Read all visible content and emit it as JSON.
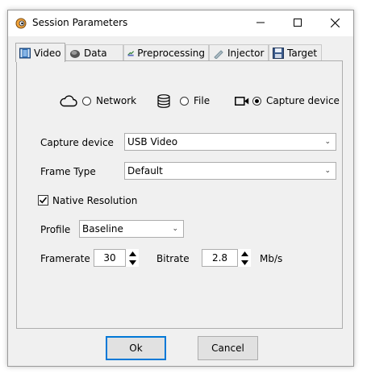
{
  "window": {
    "title": "Session Parameters"
  },
  "tabs": [
    {
      "label": "Video",
      "icon": "film-icon"
    },
    {
      "label": "Data",
      "icon": "disk-icon"
    },
    {
      "label": "Preprocessing",
      "icon": "preprocess-icon"
    },
    {
      "label": "Injector",
      "icon": "pen-icon"
    },
    {
      "label": "Target",
      "icon": "floppy-icon"
    }
  ],
  "source": {
    "network_label": "Network",
    "file_label": "File",
    "capture_label": "Capture device",
    "selected": "Capture device"
  },
  "capture_device": {
    "label": "Capture device",
    "value": "USB Video"
  },
  "frame_type": {
    "label": "Frame Type",
    "value": "Default"
  },
  "native_resolution": {
    "label": "Native Resolution",
    "checked": true
  },
  "profile": {
    "label": "Profile",
    "value": "Baseline"
  },
  "framerate": {
    "label": "Framerate",
    "value": "30"
  },
  "bitrate": {
    "label": "Bitrate",
    "value": "2.8",
    "unit": "Mb/s"
  },
  "buttons": {
    "ok": "Ok",
    "cancel": "Cancel"
  }
}
